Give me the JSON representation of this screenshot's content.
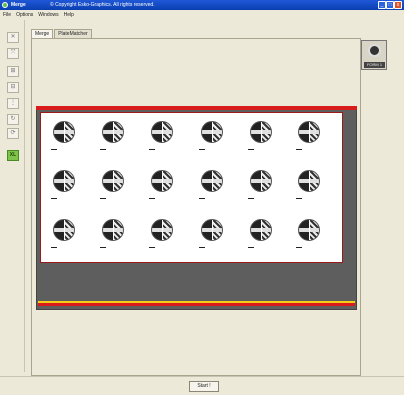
{
  "window": {
    "app_name": "Merge",
    "copyright": "© Copyright Esko-Graphics. All rights reserved.",
    "min_glyph": "_",
    "max_glyph": "□",
    "close_glyph": "x"
  },
  "menu": {
    "items": [
      "File",
      "Options",
      "Windows",
      "Help"
    ]
  },
  "toolbar": {
    "tools": [
      {
        "icon": "crosshair-icon",
        "glyph": "✕"
      },
      {
        "icon": "stretch-icon",
        "glyph": "⤧"
      },
      {
        "icon": "align-icon",
        "glyph": "⊞"
      },
      {
        "icon": "distribute-icon",
        "glyph": "⊟"
      },
      {
        "icon": "spacing-icon",
        "glyph": "⋮"
      },
      {
        "icon": "rotate-icon",
        "glyph": "↻"
      },
      {
        "icon": "refresh-icon",
        "glyph": "⟳"
      },
      {
        "icon": "layout-icon",
        "glyph": "XL",
        "active": true
      }
    ]
  },
  "tabs": [
    {
      "label": "Merge",
      "selected": true
    },
    {
      "label": "PlateMatcher",
      "selected": false
    }
  ],
  "thumbnail": {
    "label": "FORM 1"
  },
  "footer": {
    "start_label": "Start !"
  },
  "colors": {
    "title_blue": "#0a3fb0",
    "sheet_border_red": "#d81c1c",
    "highlight_yellow": "#f4cc1a",
    "press_gray": "#5e5e5e",
    "active_tool_green": "#7fc44a"
  }
}
